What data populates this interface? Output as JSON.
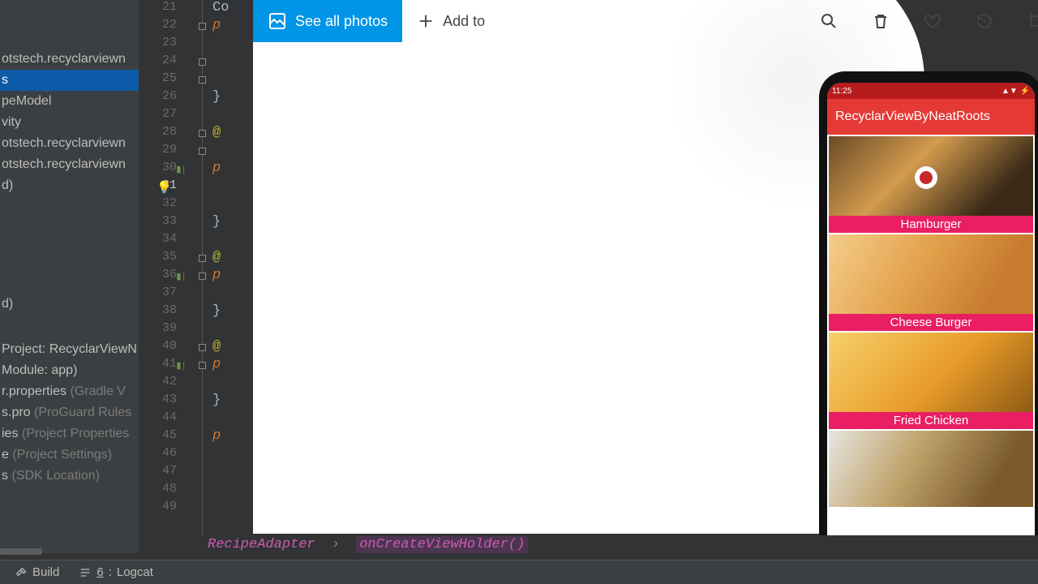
{
  "project_panel": {
    "top_items": [
      {
        "label": "otstech.recyclarviewn",
        "selected": false
      },
      {
        "label": "s",
        "selected": true
      },
      {
        "label": "",
        "selected": false
      },
      {
        "label": "peModel",
        "selected": false
      },
      {
        "label": "vity",
        "selected": false
      },
      {
        "label": "otstech.recyclarviewn",
        "selected": false
      },
      {
        "label": "otstech.recyclarviewn",
        "selected": false
      },
      {
        "label": "d)",
        "selected": false
      }
    ],
    "mid_items": [
      {
        "label": "d)",
        "grey": ""
      }
    ],
    "bottom_items": [
      {
        "label": "Project: RecyclarViewN",
        "grey": ""
      },
      {
        "label": "Module: app)",
        "grey": ""
      },
      {
        "label": "r.properties",
        "grey": " (Gradle V"
      },
      {
        "label": "s.pro",
        "grey": " (ProGuard Rules"
      },
      {
        "label": "ies",
        "grey": " (Project Properties"
      },
      {
        "label": "e",
        "grey": " (Project Settings)"
      },
      {
        "label": "s",
        "grey": " (SDK Location)"
      }
    ]
  },
  "gutter": {
    "start": 21,
    "end": 49,
    "current": 31,
    "vcs_marks": {
      "30": "green_red",
      "36": "green_red",
      "41": "green_red"
    },
    "bulb_line": 31
  },
  "code_rows": {
    "21": {
      "cls": "tok-txt",
      "t": "Co"
    },
    "22": {
      "cls": "tok-kw",
      "t": "p"
    },
    "23": {
      "cls": "",
      "t": ""
    },
    "24": {
      "cls": "",
      "t": ""
    },
    "25": {
      "cls": "",
      "t": ""
    },
    "26": {
      "cls": "tok-brace",
      "t": "}"
    },
    "27": {
      "cls": "",
      "t": ""
    },
    "28": {
      "cls": "tok-ann",
      "t": "@"
    },
    "29": {
      "cls": "",
      "t": ""
    },
    "30": {
      "cls": "tok-kw",
      "t": "p"
    },
    "31": {
      "cls": "",
      "t": ""
    },
    "32": {
      "cls": "",
      "t": ""
    },
    "33": {
      "cls": "tok-brace",
      "t": "}"
    },
    "34": {
      "cls": "",
      "t": ""
    },
    "35": {
      "cls": "tok-ann",
      "t": "@"
    },
    "36": {
      "cls": "tok-kw",
      "t": "p"
    },
    "37": {
      "cls": "",
      "t": ""
    },
    "38": {
      "cls": "tok-brace",
      "t": "}"
    },
    "39": {
      "cls": "",
      "t": ""
    },
    "40": {
      "cls": "tok-ann",
      "t": "@"
    },
    "41": {
      "cls": "tok-kw",
      "t": "p"
    },
    "42": {
      "cls": "",
      "t": ""
    },
    "43": {
      "cls": "tok-brace",
      "t": "}"
    },
    "44": {
      "cls": "",
      "t": ""
    },
    "45": {
      "cls": "tok-kw",
      "t": "p"
    },
    "46": {
      "cls": "",
      "t": ""
    },
    "47": {
      "cls": "",
      "t": ""
    },
    "48": {
      "cls": "",
      "t": ""
    },
    "49": {
      "cls": "",
      "t": ""
    }
  },
  "photos_bar": {
    "see_all": "See all photos",
    "add_to": "Add to"
  },
  "phone": {
    "status_time": "11:25",
    "status_icons": "▲▼ ⚡",
    "app_title": "RecyclarViewByNeatRoots",
    "cards": [
      {
        "label": "Hamburger"
      },
      {
        "label": "Cheese Burger"
      },
      {
        "label": "Fried Chicken"
      },
      {
        "label": ""
      }
    ]
  },
  "breadcrumb": {
    "a": "RecipeAdapter",
    "b": "onCreateViewHolder()"
  },
  "bottom_tabs": {
    "build": "Build",
    "logcat_key": "6",
    "logcat": "Logcat"
  }
}
